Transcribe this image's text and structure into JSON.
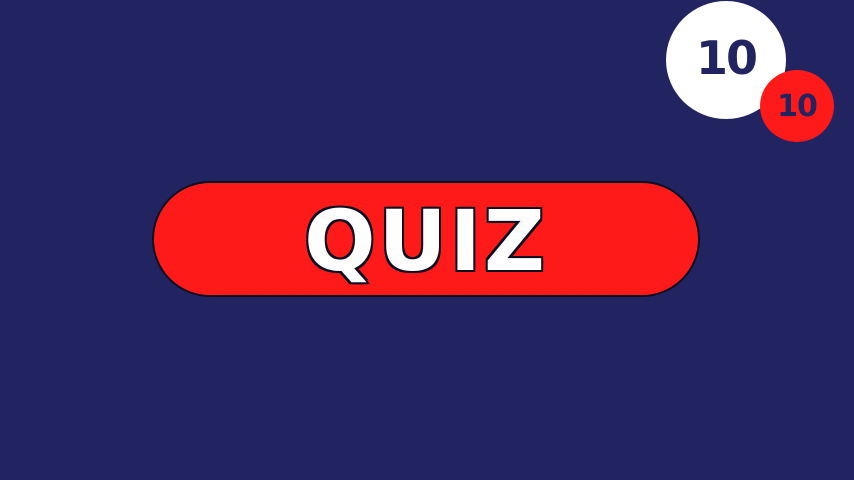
{
  "title": "QUIZ",
  "score": {
    "current": "10",
    "total": "10"
  },
  "colors": {
    "background": "#222361",
    "accent_red": "#ff1a1a",
    "white": "#ffffff",
    "outline": "#0d0d22"
  }
}
